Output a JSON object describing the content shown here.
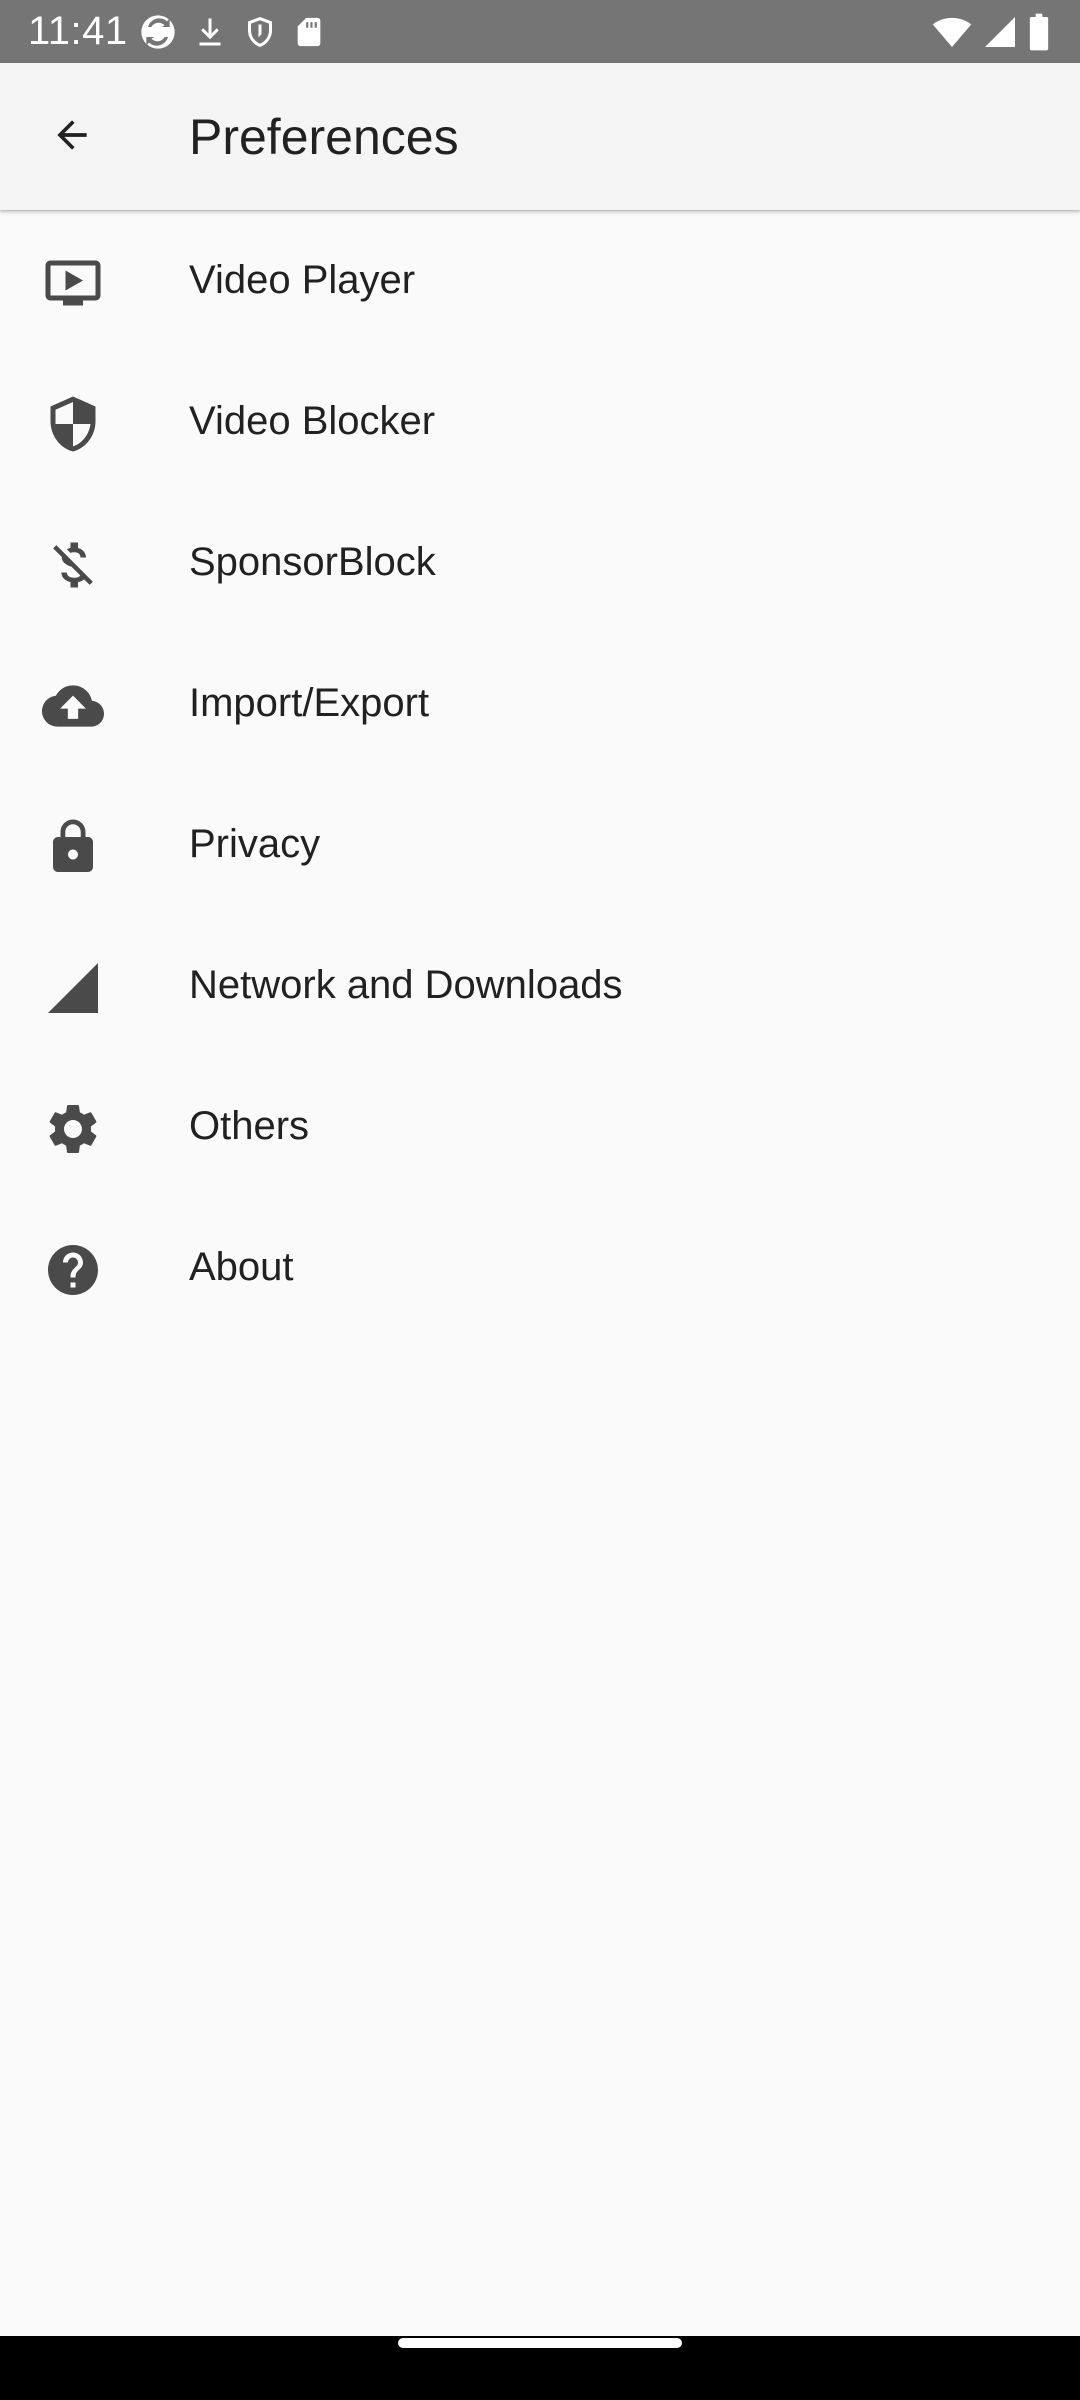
{
  "status_bar": {
    "time": "11:41",
    "icons": [
      "sync-icon",
      "download-icon",
      "shield-outline-icon",
      "sd-card-icon",
      "wifi-icon",
      "cell-signal-icon",
      "battery-icon"
    ]
  },
  "app_bar": {
    "back_icon": "arrow-back-icon",
    "title": "Preferences"
  },
  "preferences": [
    {
      "label": "Video Player",
      "icon": "tv-play-icon"
    },
    {
      "label": "Video Blocker",
      "icon": "shield-icon"
    },
    {
      "label": "SponsorBlock",
      "icon": "money-off-icon"
    },
    {
      "label": "Import/Export",
      "icon": "cloud-upload-icon"
    },
    {
      "label": "Privacy",
      "icon": "lock-icon"
    },
    {
      "label": "Network and Downloads",
      "icon": "signal-icon"
    },
    {
      "label": "Others",
      "icon": "gear-icon"
    },
    {
      "label": "About",
      "icon": "help-icon"
    }
  ],
  "colors": {
    "status_bar": "#757575",
    "app_bar": "#f5f5f5",
    "background": "#fafafa",
    "icon": "#4a4a4a",
    "text": "#212121"
  }
}
